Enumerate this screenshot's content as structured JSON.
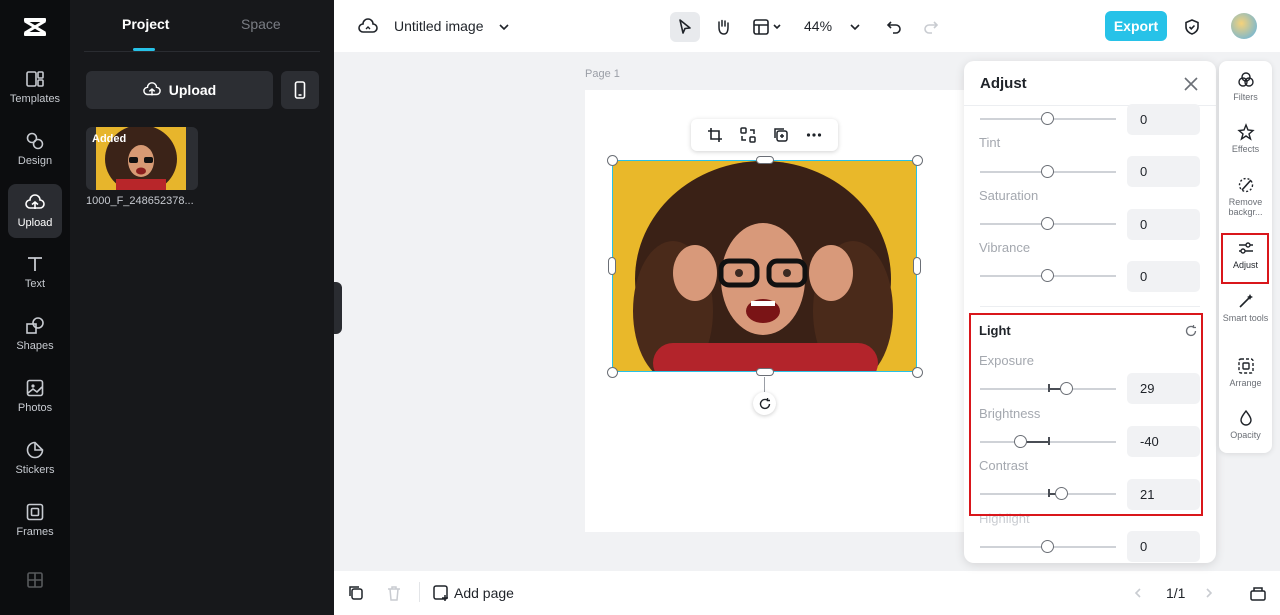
{
  "rail": {
    "items": [
      {
        "label": "Templates",
        "icon": "templates-icon"
      },
      {
        "label": "Design",
        "icon": "design-icon"
      },
      {
        "label": "Upload",
        "icon": "upload-cloud-icon",
        "active": true
      },
      {
        "label": "Text",
        "icon": "text-icon"
      },
      {
        "label": "Shapes",
        "icon": "shapes-icon"
      },
      {
        "label": "Photos",
        "icon": "photos-icon"
      },
      {
        "label": "Stickers",
        "icon": "stickers-icon"
      },
      {
        "label": "Frames",
        "icon": "frames-icon"
      }
    ]
  },
  "panel": {
    "tabs": [
      "Project",
      "Space"
    ],
    "upload_label": "Upload",
    "asset": {
      "badge": "Added",
      "filename": "1000_F_248652378..."
    }
  },
  "topbar": {
    "title": "Untitled image",
    "zoom": "44%",
    "export_label": "Export"
  },
  "canvas": {
    "page_label": "Page 1"
  },
  "bottombar": {
    "add_page_label": "Add page",
    "page_count": "1/1"
  },
  "adjust": {
    "title": "Adjust",
    "color_sliders": [
      {
        "label": "",
        "value": "0",
        "position": 0.5
      },
      {
        "label": "Tint",
        "value": "0",
        "position": 0.5
      },
      {
        "label": "Saturation",
        "value": "0",
        "position": 0.5
      },
      {
        "label": "Vibrance",
        "value": "0",
        "position": 0.5
      }
    ],
    "light": {
      "title": "Light",
      "sliders": [
        {
          "label": "Exposure",
          "value": "29"
        },
        {
          "label": "Brightness",
          "value": "-40"
        },
        {
          "label": "Contrast",
          "value": "21"
        },
        {
          "label": "Highlight",
          "value": "0"
        }
      ]
    }
  },
  "sidetools": {
    "items": [
      {
        "label": "Filters",
        "icon": "filters-icon"
      },
      {
        "label": "Effects",
        "icon": "effects-icon"
      },
      {
        "label": "Remove backgr...",
        "icon": "remove-background-icon"
      },
      {
        "label": "Adjust",
        "icon": "adjust-sliders-icon",
        "active": true
      },
      {
        "label": "Smart tools",
        "icon": "smart-tools-icon"
      },
      {
        "label": "Arrange",
        "icon": "arrange-icon"
      },
      {
        "label": "Opacity",
        "icon": "opacity-icon"
      }
    ]
  },
  "colors": {
    "accent": "#27c2e8",
    "highlight_border": "#d9161b",
    "rail_bg": "#0c0d0f",
    "panel_bg": "#17181b"
  }
}
